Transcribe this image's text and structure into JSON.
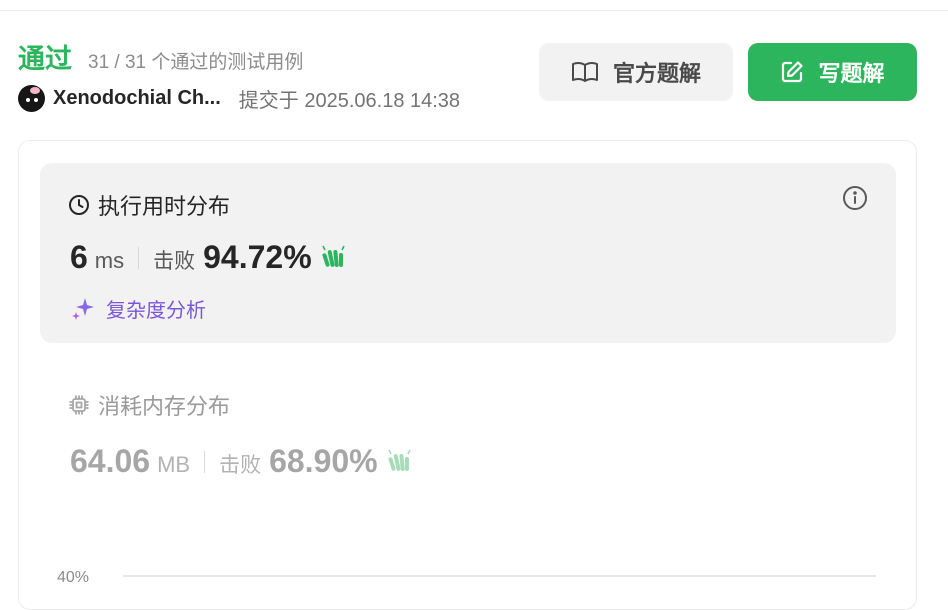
{
  "status": {
    "title": "通过",
    "subtitle": "31 / 31 个通过的测试用例"
  },
  "author": {
    "name": "Xenodochial Ch...",
    "submitted": "提交于 2025.06.18 14:38"
  },
  "actions": {
    "official_solution": "官方题解",
    "write_solution": "写题解"
  },
  "runtime": {
    "title": "执行用时分布",
    "value": "6",
    "unit": "ms",
    "beat_label": "击败",
    "beat_value": "94.72%",
    "complexity_link": "复杂度分析"
  },
  "memory": {
    "title": "消耗内存分布",
    "value": "64.06",
    "unit": "MB",
    "beat_label": "击败",
    "beat_value": "68.90%"
  },
  "chart": {
    "axis_label": "40%"
  },
  "colors": {
    "accent": "#2db55d",
    "purple": "#7b56d9",
    "muted": "#a6a6a6"
  },
  "icons": [
    "book-icon",
    "edit-icon",
    "clock-icon",
    "info-icon",
    "clap-icon",
    "sparkle-icon",
    "chip-icon"
  ]
}
